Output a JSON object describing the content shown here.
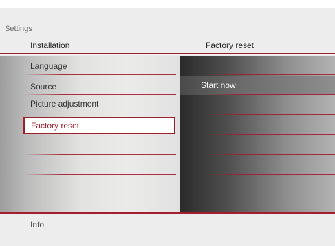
{
  "breadcrumb": "Settings",
  "headers": {
    "left": "Installation",
    "right": "Factory reset"
  },
  "menu": {
    "items": [
      {
        "label": "Language"
      },
      {
        "label": "Source"
      },
      {
        "label": "Picture adjustment"
      },
      {
        "label": "Factory reset"
      }
    ],
    "selected_index": 3
  },
  "options": {
    "start_label": "Start now"
  },
  "footer": {
    "info": "Info"
  },
  "colors": {
    "accent": "#a01e2e",
    "background": "#ededed"
  }
}
